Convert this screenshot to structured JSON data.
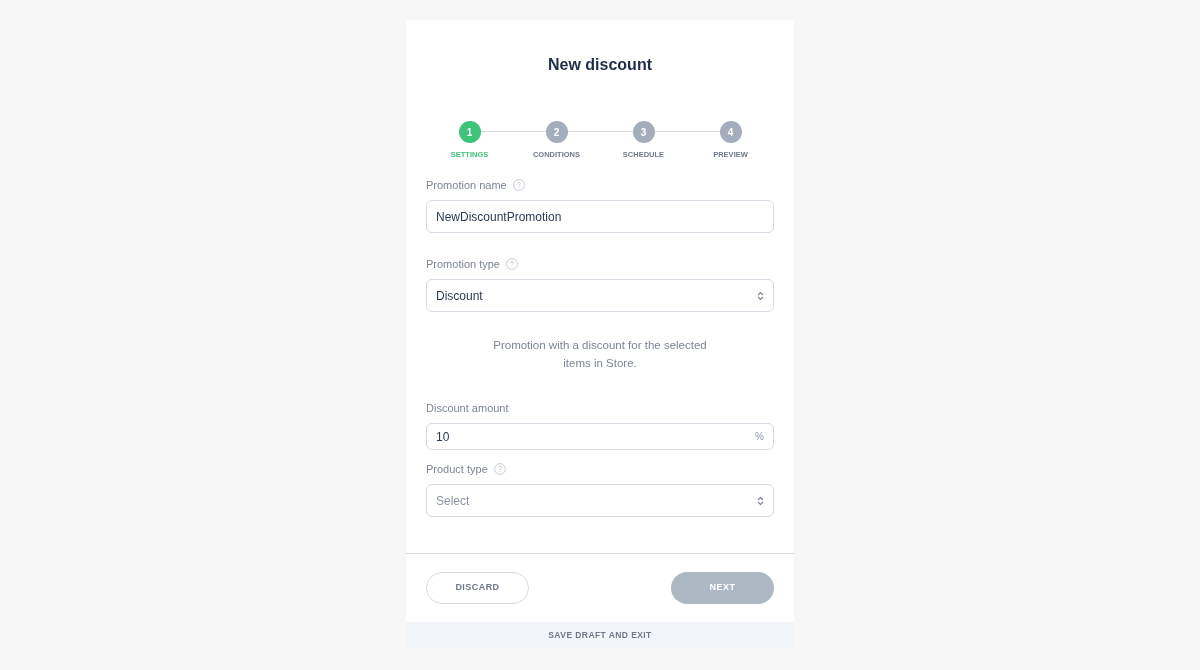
{
  "title": "New discount",
  "steps": [
    {
      "number": "1",
      "label": "SETTINGS",
      "selected": true
    },
    {
      "number": "2",
      "label": "CONDITIONS",
      "selected": false
    },
    {
      "number": "3",
      "label": "SCHEDULE",
      "selected": false
    },
    {
      "number": "4",
      "label": "PREVIEW",
      "selected": false
    }
  ],
  "fields": [
    {
      "kind": "text",
      "label": "Promotion name",
      "help": true,
      "value": "NewDiscountPromotion"
    },
    {
      "kind": "select",
      "label": "Promotion type",
      "help": true,
      "value": "Discount",
      "description": "Promotion with a discount for the selected items in Store."
    },
    {
      "kind": "amount",
      "label": "Discount amount",
      "help": false,
      "value": "10",
      "unit": "%"
    },
    {
      "kind": "select",
      "label": "Product type",
      "help": true,
      "placeholder": "Select"
    }
  ],
  "buttons": {
    "discard": {
      "label": "DISCARD"
    },
    "next": {
      "label": "NEXT",
      "disabled": true
    }
  },
  "footer_link": "SAVE DRAFT AND EXIT"
}
